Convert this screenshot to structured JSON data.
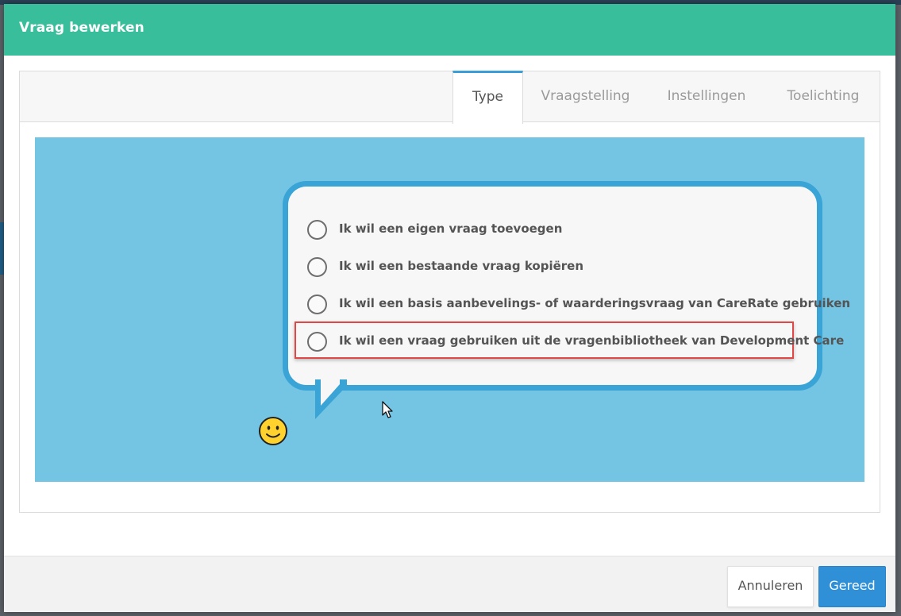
{
  "modal": {
    "title": "Vraag bewerken"
  },
  "tabs": [
    {
      "label": "Type",
      "active": true
    },
    {
      "label": "Vraagstelling",
      "active": false
    },
    {
      "label": "Instellingen",
      "active": false
    },
    {
      "label": "Toelichting",
      "active": false
    }
  ],
  "options": [
    {
      "label": "Ik wil een eigen vraag toevoegen",
      "selected": false
    },
    {
      "label": "Ik wil een bestaande vraag kopiëren",
      "selected": false
    },
    {
      "label": "Ik wil een basis aanbevelings- of waarderingsvraag van CareRate gebruiken",
      "selected": false
    },
    {
      "label": "Ik wil een vraag gebruiken uit de vragenbibliotheek van Development Care",
      "selected": false,
      "highlighted": true
    }
  ],
  "footer": {
    "cancel_label": "Annuleren",
    "done_label": "Gereed"
  },
  "colors": {
    "header": "#38be9a",
    "illustration_background": "#74c5e4",
    "bubble_border": "#3aa4d6",
    "highlight": "#e04848",
    "primary_button": "#2f90d8"
  },
  "icons": {
    "smiley": "smiley-face-icon",
    "cursor": "mouse-pointer-icon"
  }
}
